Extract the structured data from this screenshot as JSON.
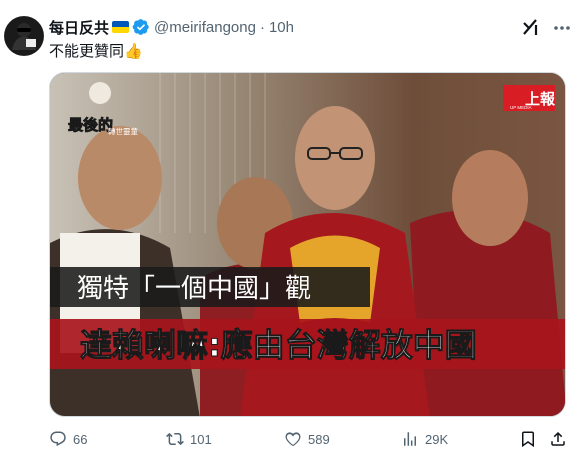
{
  "tweet": {
    "display_name": "每日反共",
    "handle": "@meirifangong",
    "separator": "·",
    "time": "10h",
    "text": "不能更贊同👍"
  },
  "media": {
    "top_right_logo": "上報",
    "top_right_logo_sub": "UP MEDIA",
    "top_left_badge": "最後的",
    "top_left_badge_2": "轉世靈童",
    "headline_1": "獨特「一個中國」觀",
    "headline_2": "達賴喇嘛:應由台灣解放中國"
  },
  "actions": {
    "replies": "66",
    "retweets": "101",
    "likes": "589",
    "views": "29K"
  },
  "colors": {
    "accent": "#1d9bf0",
    "muted": "#536471",
    "robe_red": "#9b1b1f",
    "robe_gold": "#e5a52a"
  },
  "icons": [
    "avatar-icon",
    "verified-badge-icon",
    "ukraine-flag-icon",
    "grok-icon",
    "more-icon",
    "reply-icon",
    "retweet-icon",
    "like-icon",
    "views-icon",
    "bookmark-icon",
    "share-icon"
  ]
}
